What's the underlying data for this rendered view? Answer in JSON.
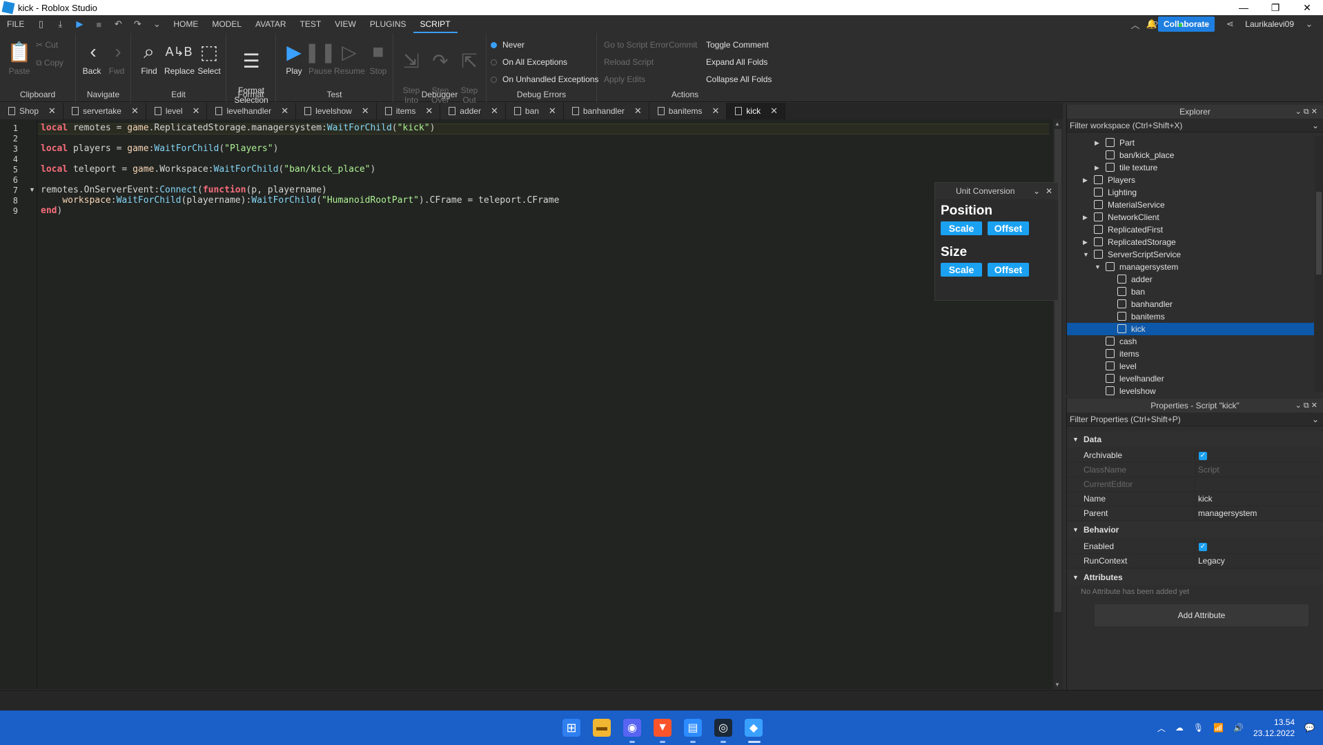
{
  "window": {
    "title": "kick - Roblox Studio",
    "controls": [
      "—",
      "❐",
      "✕"
    ]
  },
  "menubar": {
    "items": [
      "FILE",
      "HOME",
      "MODEL",
      "AVATAR",
      "TEST",
      "VIEW",
      "PLUGINS",
      "SCRIPT"
    ],
    "active": "SCRIPT",
    "collaborate": "Collaborate",
    "user": "Laurikalevi09"
  },
  "ribbon": {
    "clipboard": {
      "label": "Clipboard",
      "paste": "Paste",
      "cut": "Cut",
      "copy": "Copy"
    },
    "navigate": {
      "label": "Navigate",
      "back": "Back",
      "fwd": "Fwd"
    },
    "edit": {
      "label": "Edit",
      "find": "Find",
      "replace": "Replace",
      "select": "Select"
    },
    "format": {
      "label": "Format",
      "format_selection": "Format\nSelection"
    },
    "test": {
      "label": "Test",
      "play": "Play",
      "pause": "Pause",
      "resume": "Resume",
      "stop": "Stop"
    },
    "debugger": {
      "label": "Debugger",
      "step_into": "Step\nInto",
      "step_over": "Step\nOver",
      "step_out": "Step\nOut"
    },
    "debug_errors": {
      "label": "Debug Errors",
      "never": "Never",
      "on_all": "On All Exceptions",
      "on_unhandled": "On Unhandled Exceptions"
    },
    "actions": {
      "label": "Actions",
      "go_to_error": "Go to Script Error",
      "commit": "Commit",
      "reload": "Reload Script",
      "apply_edits": "Apply Edits",
      "toggle_comment": "Toggle Comment",
      "expand_folds": "Expand All Folds",
      "collapse_folds": "Collapse All Folds"
    }
  },
  "tabs": [
    "Shop",
    "servertake",
    "level",
    "levelhandler",
    "levelshow",
    "items",
    "adder",
    "ban",
    "banhandler",
    "banitems",
    "kick"
  ],
  "active_tab": "kick",
  "code": {
    "line_numbers": [
      "1",
      "2",
      "3",
      "4",
      "5",
      "6",
      "7",
      "8",
      "9"
    ],
    "line1": {
      "kw": "local",
      "name": " remotes ",
      "eq": "=",
      "sp": " ",
      "game": "game",
      "d1": ".",
      "rs": "ReplicatedStorage",
      "d2": ".",
      "ms": "managersystem",
      "c": ":",
      "wfc": "WaitForChild",
      "p1": "(",
      "str": "\"kick\"",
      "p2": ")"
    },
    "line3": {
      "kw": "local",
      "name": " players ",
      "eq": "=",
      "sp": " ",
      "game": "game",
      "c": ":",
      "wfc": "WaitForChild",
      "p1": "(",
      "str": "\"Players\"",
      "p2": ")"
    },
    "line5": {
      "kw": "local",
      "name": " teleport ",
      "eq": "=",
      "sp": " ",
      "game": "game",
      "d1": ".",
      "ws": "Workspace",
      "c": ":",
      "wfc": "WaitForChild",
      "p1": "(",
      "str": "\"ban/kick_place\"",
      "p2": ")"
    },
    "line7": {
      "remotes": "remotes",
      "d1": ".",
      "ev": "OnServerEvent",
      "c": ":",
      "conn": "Connect",
      "p1": "(",
      "fn": "function",
      "args": "(p, playername)"
    },
    "line8": {
      "indent": "    ",
      "ws": "workspace",
      "c1": ":",
      "wfc1": "WaitForChild",
      "a1": "(playername)",
      "c2": ":",
      "wfc2": "WaitForChild",
      "p1": "(",
      "str": "\"HumanoidRootPart\"",
      "p2": ")",
      "rest": ".CFrame = teleport.CFrame"
    },
    "line9": {
      "end": "end",
      "p": ")"
    }
  },
  "unit_conversion": {
    "title": "Unit Conversion",
    "position": "Position",
    "size": "Size",
    "scale": "Scale",
    "offset": "Offset"
  },
  "explorer": {
    "title": "Explorer",
    "filter": "Filter workspace (Ctrl+Shift+X)",
    "items": [
      {
        "label": "Part",
        "indent": 2,
        "arrow": "▶"
      },
      {
        "label": "ban/kick_place",
        "indent": 2,
        "arrow": ""
      },
      {
        "label": "tile texture",
        "indent": 2,
        "arrow": "▶"
      },
      {
        "label": "Players",
        "indent": 1,
        "arrow": "▶"
      },
      {
        "label": "Lighting",
        "indent": 1,
        "arrow": ""
      },
      {
        "label": "MaterialService",
        "indent": 1,
        "arrow": ""
      },
      {
        "label": "NetworkClient",
        "indent": 1,
        "arrow": "▶"
      },
      {
        "label": "ReplicatedFirst",
        "indent": 1,
        "arrow": ""
      },
      {
        "label": "ReplicatedStorage",
        "indent": 1,
        "arrow": "▶"
      },
      {
        "label": "ServerScriptService",
        "indent": 1,
        "arrow": "▼"
      },
      {
        "label": "managersystem",
        "indent": 2,
        "arrow": "▼"
      },
      {
        "label": "adder",
        "indent": 3,
        "arrow": ""
      },
      {
        "label": "ban",
        "indent": 3,
        "arrow": ""
      },
      {
        "label": "banhandler",
        "indent": 3,
        "arrow": ""
      },
      {
        "label": "banitems",
        "indent": 3,
        "arrow": ""
      },
      {
        "label": "kick",
        "indent": 3,
        "arrow": "",
        "selected": true
      },
      {
        "label": "cash",
        "indent": 2,
        "arrow": ""
      },
      {
        "label": "items",
        "indent": 2,
        "arrow": ""
      },
      {
        "label": "level",
        "indent": 2,
        "arrow": ""
      },
      {
        "label": "levelhandler",
        "indent": 2,
        "arrow": ""
      },
      {
        "label": "levelshow",
        "indent": 2,
        "arrow": ""
      }
    ]
  },
  "properties": {
    "title": "Properties - Script \"kick\"",
    "filter": "Filter Properties (Ctrl+Shift+P)",
    "data_section": "Data",
    "archivable": "Archivable",
    "classname": "ClassName",
    "classname_value": "Script",
    "current_editor": "CurrentEditor",
    "name": "Name",
    "name_value": "kick",
    "parent": "Parent",
    "parent_value": "managersystem",
    "behavior_section": "Behavior",
    "enabled": "Enabled",
    "runcontext": "RunContext",
    "runcontext_value": "Legacy",
    "attributes_section": "Attributes",
    "no_attributes": "No Attribute has been added yet",
    "add_attribute": "Add Attribute"
  },
  "taskbar": {
    "time": "13.54",
    "date": "23.12.2022"
  },
  "colors": {
    "accent": "#3aa0ff",
    "selection": "#0d58a8",
    "button_blue": "#1ba1f2",
    "taskbar": "#1b5fc9"
  }
}
